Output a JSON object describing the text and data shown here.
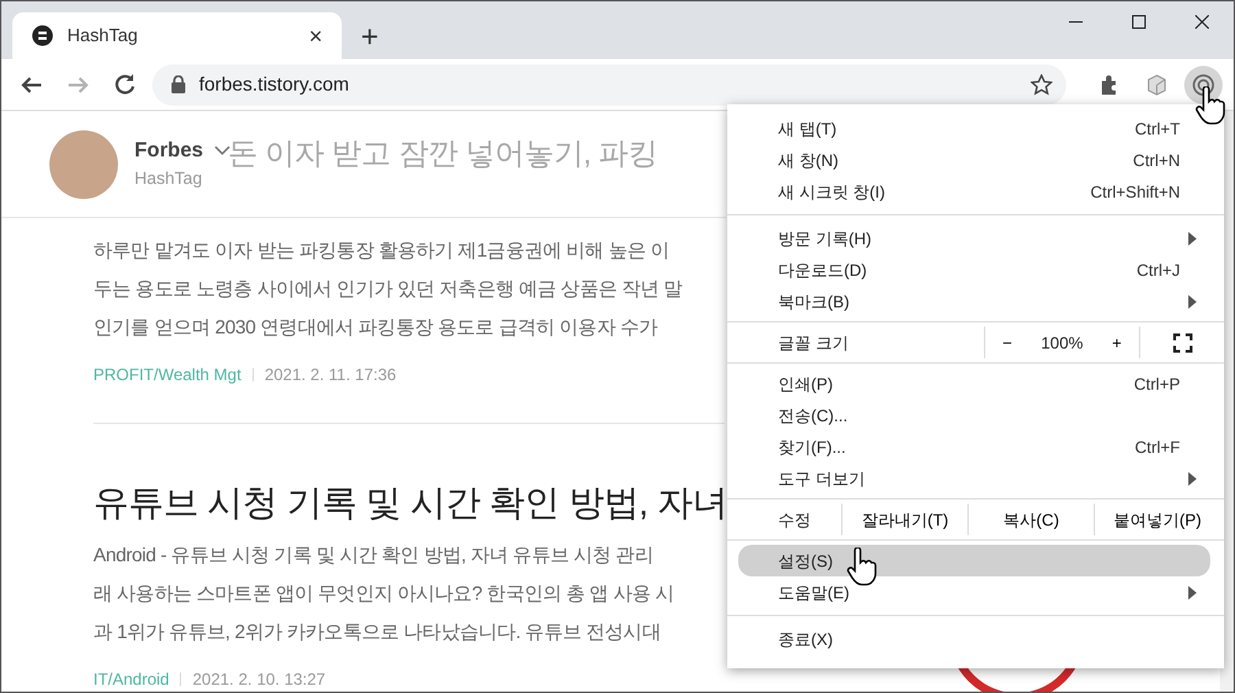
{
  "browser": {
    "tab": {
      "title": "HashTag",
      "close": "×"
    },
    "new_tab": "+",
    "address": "forbes.tistory.com",
    "back_enabled": true,
    "forward_enabled": false
  },
  "blog": {
    "name": "Forbes",
    "subtitle": "HashTag"
  },
  "posts": [
    {
      "title": "돈 이자 받고 잠깐 넣어놓기, 파킹",
      "faded": true,
      "excerpt_lines": [
        "하루만 맡겨도 이자 받는 파킹통장 활용하기 제1금융권에 비해 높은 이",
        "두는 용도로 노령층 사이에서 인기가 있던 저축은행 예금 상품은 작년 말",
        "인기를 얻으며 2030 연령대에서 파킹통장 용도로 급격히 이용자 수가"
      ],
      "category": "PROFIT/Wealth Mgt",
      "date": "2021. 2. 11. 17:36"
    },
    {
      "title": "유튜브 시청 기록 및 시간 확인 방법, 자녀",
      "faded": false,
      "excerpt_lines": [
        "Android - 유튜브 시청 기록 및 시간 확인 방법, 자녀 유튜브 시청 관리",
        "래 사용하는 스마트폰 앱이 무엇인지 아시나요? 한국인의 총 앱 사용 시",
        "과 1위가 유튜브, 2위가 카카오톡으로 나타났습니다. 유튜브 전성시대"
      ],
      "category": "IT/Android",
      "date": "2021. 2. 10. 13:27"
    }
  ],
  "menu": {
    "groups": [
      [
        {
          "kind": "item",
          "label": "새 탭(T)",
          "shortcut": "Ctrl+T",
          "submenu": false,
          "highlighted": false
        },
        {
          "kind": "item",
          "label": "새 창(N)",
          "shortcut": "Ctrl+N",
          "submenu": false,
          "highlighted": false
        },
        {
          "kind": "item",
          "label": "새 시크릿 창(I)",
          "shortcut": "Ctrl+Shift+N",
          "submenu": false,
          "highlighted": false
        }
      ],
      [
        {
          "kind": "item",
          "label": "방문 기록(H)",
          "submenu": true,
          "highlighted": false
        },
        {
          "kind": "item",
          "label": "다운로드(D)",
          "shortcut": "Ctrl+J",
          "submenu": false,
          "highlighted": false
        },
        {
          "kind": "item",
          "label": "북마크(B)",
          "submenu": true,
          "highlighted": false
        }
      ],
      [
        {
          "kind": "zoom",
          "label": "글꼴 크기",
          "minus": "−",
          "value": "100%",
          "plus": "+"
        }
      ],
      [
        {
          "kind": "item",
          "label": "인쇄(P)",
          "shortcut": "Ctrl+P",
          "submenu": false,
          "highlighted": false
        },
        {
          "kind": "item",
          "label": "전송(C)...",
          "submenu": false,
          "highlighted": false
        },
        {
          "kind": "item",
          "label": "찾기(F)...",
          "shortcut": "Ctrl+F",
          "submenu": false,
          "highlighted": false
        },
        {
          "kind": "item",
          "label": "도구 더보기",
          "submenu": true,
          "highlighted": false
        }
      ],
      [
        {
          "kind": "edit",
          "label": "수정",
          "actions": [
            "잘라내기(T)",
            "복사(C)",
            "붙여넣기(P)"
          ]
        }
      ],
      [
        {
          "kind": "item",
          "label": "설정(S)",
          "submenu": false,
          "highlighted": true
        },
        {
          "kind": "item",
          "label": "도움말(E)",
          "submenu": true,
          "highlighted": false
        }
      ],
      [
        {
          "kind": "item",
          "label": "종료(X)",
          "submenu": false,
          "highlighted": false
        }
      ]
    ]
  }
}
